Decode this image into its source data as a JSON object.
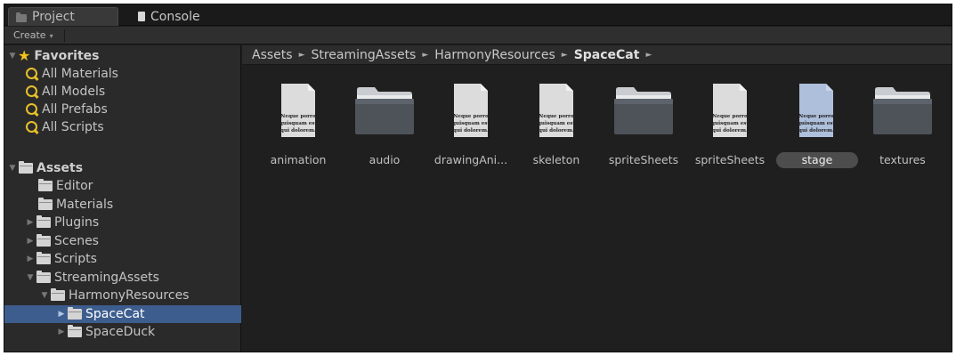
{
  "tabs": [
    {
      "label": "Project",
      "icon": "folder-icon",
      "active": true
    },
    {
      "label": "Console",
      "icon": "console-icon",
      "active": false
    }
  ],
  "toolbar": {
    "create_label": "Create",
    "create_caret": "▾"
  },
  "tree": {
    "favorites": {
      "label": "Favorites",
      "items": [
        {
          "label": "All Materials"
        },
        {
          "label": "All Models"
        },
        {
          "label": "All Prefabs"
        },
        {
          "label": "All Scripts"
        }
      ]
    },
    "assets": {
      "label": "Assets",
      "items": [
        {
          "label": "Editor",
          "expandable": false
        },
        {
          "label": "Materials",
          "expandable": false
        },
        {
          "label": "Plugins",
          "expandable": true
        },
        {
          "label": "Scenes",
          "expandable": true
        },
        {
          "label": "Scripts",
          "expandable": true
        },
        {
          "label": "StreamingAssets",
          "expandable": true,
          "expanded": true
        },
        {
          "label": "HarmonyResources",
          "expandable": true,
          "expanded": true
        },
        {
          "label": "SpaceCat",
          "expandable": true,
          "selected": true
        },
        {
          "label": "SpaceDuck",
          "expandable": true
        }
      ]
    }
  },
  "breadcrumb": {
    "parts": [
      "Assets",
      "StreamingAssets",
      "HarmonyResources"
    ],
    "current": "SpaceCat",
    "separator": "►"
  },
  "preview_text": [
    "Neque porro",
    "quisquam est",
    "qui dolorem."
  ],
  "assets": [
    {
      "label": "animation",
      "kind": "document"
    },
    {
      "label": "audio",
      "kind": "folder"
    },
    {
      "label": "drawingAni...",
      "kind": "document"
    },
    {
      "label": "skeleton",
      "kind": "document"
    },
    {
      "label": "spriteSheets",
      "kind": "folder"
    },
    {
      "label": "spriteSheets",
      "kind": "document"
    },
    {
      "label": "stage",
      "kind": "document",
      "selected": true
    },
    {
      "label": "textures",
      "kind": "folder"
    }
  ],
  "colors": {
    "selection_blue": "#3d5d8e",
    "favorite_star": "#f2c21e",
    "search_icon": "#e6c12a",
    "panel_dark": "#1f1f1f"
  }
}
